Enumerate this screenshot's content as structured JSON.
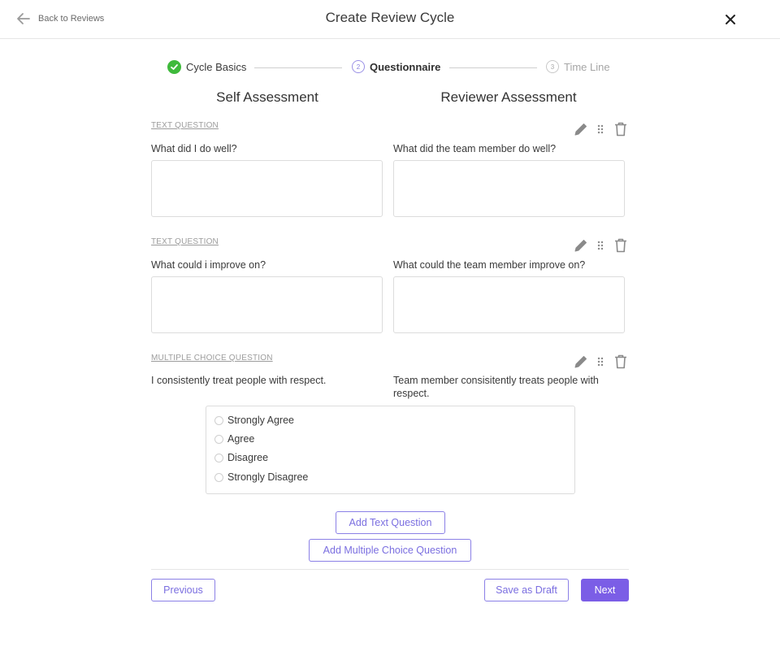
{
  "header": {
    "back_label": "Back to Reviews",
    "title": "Create Review Cycle"
  },
  "stepper": {
    "steps": [
      {
        "label": "Cycle Basics",
        "state": "complete"
      },
      {
        "number": "2",
        "label": "Questionnaire",
        "state": "active"
      },
      {
        "number": "3",
        "label": "Time Line",
        "state": "upcoming"
      }
    ]
  },
  "columns": {
    "self": "Self Assessment",
    "reviewer": "Reviewer Assessment"
  },
  "questions": [
    {
      "type": "TEXT QUESTION",
      "self": "What did I do well?",
      "reviewer": "What did the team member do well?"
    },
    {
      "type": "TEXT QUESTION",
      "self": "What could i improve on?",
      "reviewer": "What could the team member improve on?"
    },
    {
      "type": "MULTIPLE CHOICE QUESTION",
      "self": "I consistently treat people with respect.",
      "reviewer": "Team member consisitently treats people with respect.",
      "options": [
        "Strongly Agree",
        "Agree",
        "Disagree",
        "Strongly Disagree"
      ]
    }
  ],
  "actions": {
    "add_text": "Add Text Question",
    "add_mc": "Add Multiple Choice Question",
    "previous": "Previous",
    "save_draft": "Save as Draft",
    "next": "Next"
  },
  "colors": {
    "accent": "#7b5ee6",
    "success": "#3fba3c"
  }
}
